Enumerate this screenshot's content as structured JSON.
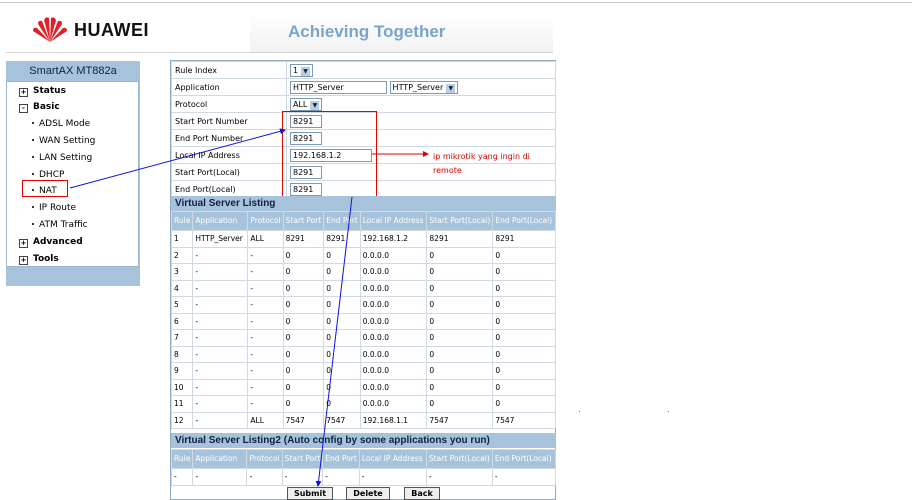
{
  "header": {
    "brand": "HUAWEI",
    "tagline": "Achieving Together"
  },
  "sidebar": {
    "model": "SmartAX MT882a",
    "items": [
      {
        "label": "Status",
        "box": "+"
      },
      {
        "label": "Basic",
        "box": "-"
      },
      {
        "label": "ADSL Mode"
      },
      {
        "label": "WAN Setting"
      },
      {
        "label": "LAN Setting"
      },
      {
        "label": "DHCP"
      },
      {
        "label": "NAT"
      },
      {
        "label": "IP Route"
      },
      {
        "label": "ATM Traffic"
      },
      {
        "label": "Advanced",
        "box": "+"
      },
      {
        "label": "Tools",
        "box": "+"
      }
    ]
  },
  "form": {
    "rule_index_label": "Rule Index",
    "rule_index_value": "1",
    "application_label": "Application",
    "application_value": "HTTP_Server",
    "application_select": "HTTP_Server",
    "protocol_label": "Protocol",
    "protocol_value": "ALL",
    "start_port_label": "Start Port Number",
    "start_port_value": "8291",
    "end_port_label": "End Port Number",
    "end_port_value": "8291",
    "local_ip_label": "Local IP Address",
    "local_ip_value": "192.168.1.2",
    "start_port_local_label": "Start Port(Local)",
    "start_port_local_value": "8291",
    "end_port_local_label": "End Port(Local)",
    "end_port_local_value": "8291"
  },
  "annotation": {
    "line1": "ip mikrotik yang ingin di",
    "line2": "remote"
  },
  "listing": {
    "title": "Virtual Server Listing",
    "headers": [
      "Rule",
      "Application",
      "Protocol",
      "Start Port",
      "End Port",
      "Local IP Address",
      "Start Port(Local)",
      "End Port(Local)"
    ],
    "rows": [
      [
        "1",
        "HTTP_Server",
        "ALL",
        "8291",
        "8291",
        "192.168.1.2",
        "8291",
        "8291"
      ],
      [
        "2",
        "-",
        "-",
        "0",
        "0",
        "0.0.0.0",
        "0",
        "0"
      ],
      [
        "3",
        "-",
        "-",
        "0",
        "0",
        "0.0.0.0",
        "0",
        "0"
      ],
      [
        "4",
        "-",
        "-",
        "0",
        "0",
        "0.0.0.0",
        "0",
        "0"
      ],
      [
        "5",
        "-",
        "-",
        "0",
        "0",
        "0.0.0.0",
        "0",
        "0"
      ],
      [
        "6",
        "-",
        "-",
        "0",
        "0",
        "0.0.0.0",
        "0",
        "0"
      ],
      [
        "7",
        "-",
        "-",
        "0",
        "0",
        "0.0.0.0",
        "0",
        "0"
      ],
      [
        "8",
        "-",
        "-",
        "0",
        "0",
        "0.0.0.0",
        "0",
        "0"
      ],
      [
        "9",
        "-",
        "-",
        "0",
        "0",
        "0.0.0.0",
        "0",
        "0"
      ],
      [
        "10",
        "-",
        "-",
        "0",
        "0",
        "0.0.0.0",
        "0",
        "0"
      ],
      [
        "11",
        "-",
        "-",
        "0",
        "0",
        "0.0.0.0",
        "0",
        "0"
      ],
      [
        "12",
        "-",
        "ALL",
        "7547",
        "7547",
        "192.168.1.1",
        "7547",
        "7547"
      ]
    ]
  },
  "listing2": {
    "title": "Virtual Server Listing2 (Auto config by some applications you run)",
    "headers": [
      "Rule",
      "Application",
      "Protocol",
      "Start Port",
      "End Port",
      "Local IP Address",
      "Start Port(Local)",
      "End Port(Local)"
    ],
    "rows": [
      [
        "-",
        "-",
        "-",
        "-",
        "-",
        "-",
        "-",
        "-"
      ]
    ]
  },
  "buttons": {
    "submit": "Submit",
    "delete": "Delete",
    "back": "Back"
  },
  "colors": {
    "accent": "#a7c3dc",
    "annotation": "#e00000",
    "arrow": "#1010e0",
    "brand_red": "#e21f26"
  },
  "stray_marks": [
    ".",
    "."
  ]
}
